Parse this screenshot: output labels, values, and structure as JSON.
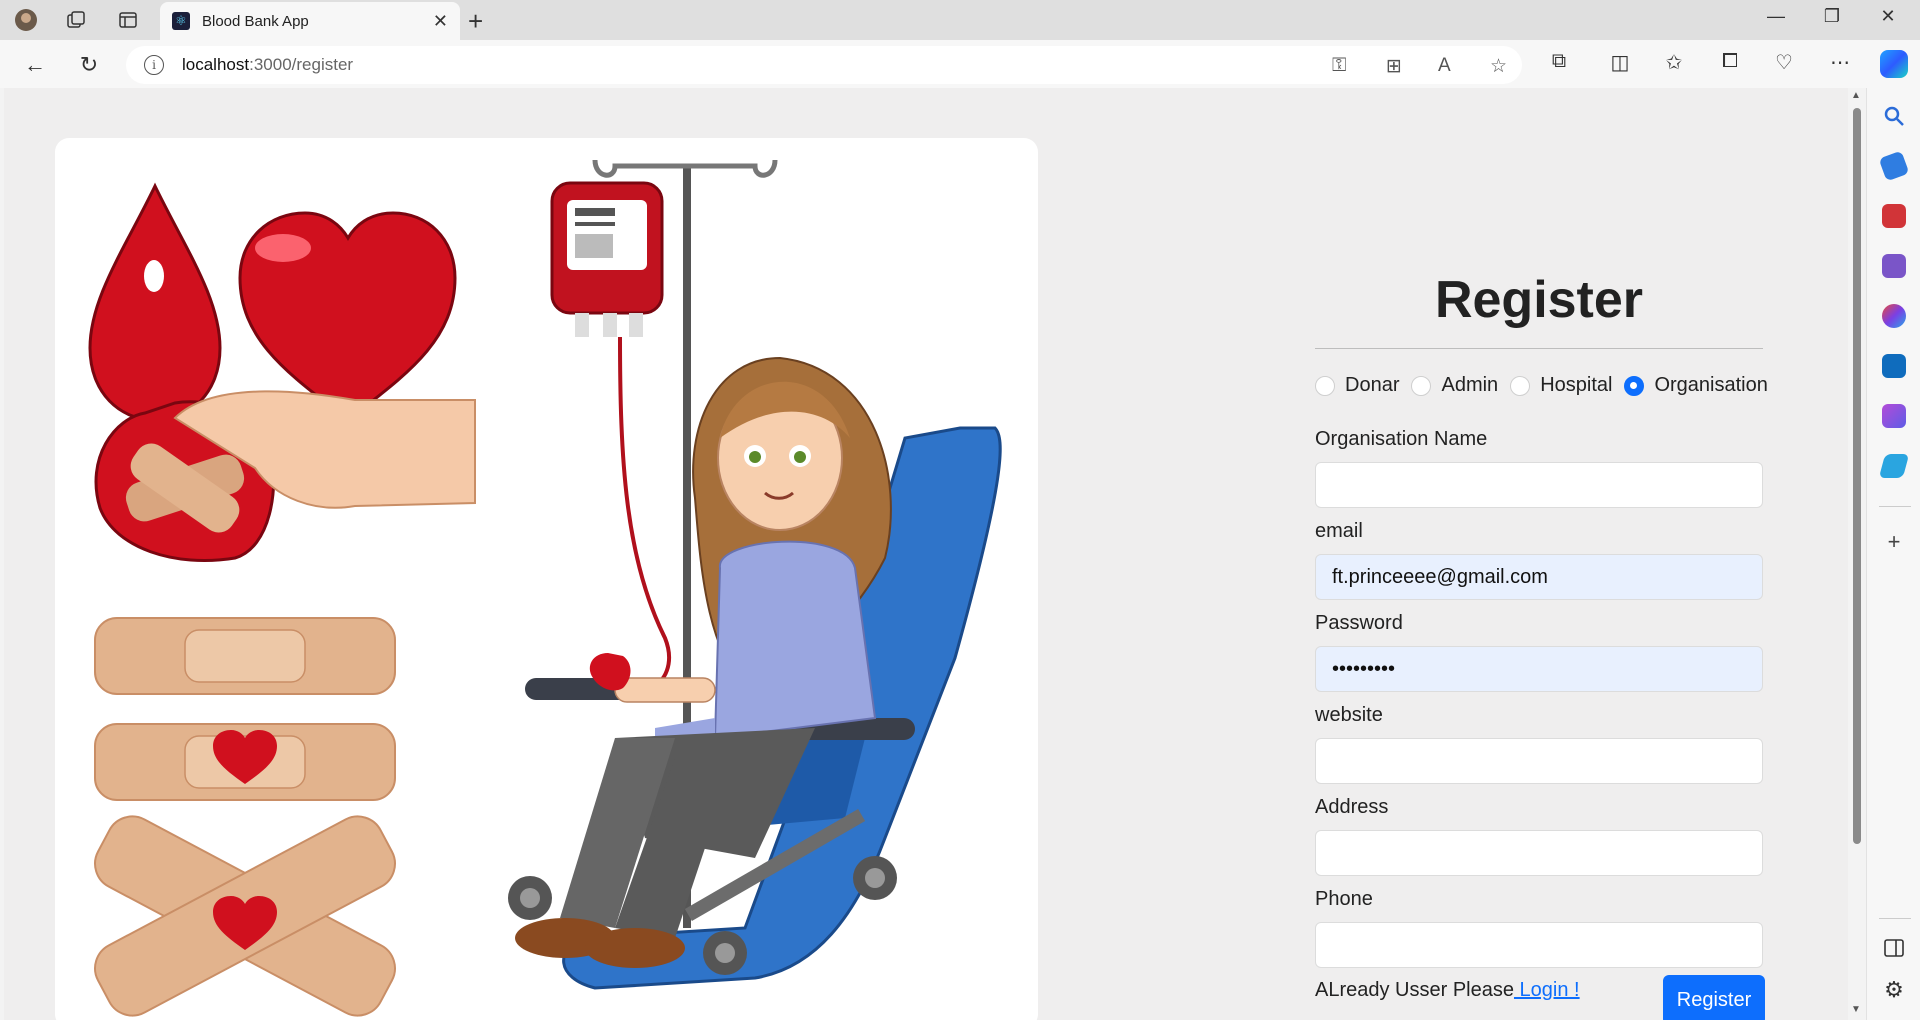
{
  "browser": {
    "tab_title": "Blood Bank App",
    "url_host": "localhost",
    "url_path": ":3000/register",
    "new_tab": "+",
    "tab_close": "✕"
  },
  "register": {
    "title": "Register",
    "roles": [
      {
        "label": "Donar",
        "checked": false
      },
      {
        "label": "Admin",
        "checked": false
      },
      {
        "label": "Hospital",
        "checked": false
      },
      {
        "label": "Organisation",
        "checked": true
      }
    ],
    "fields": {
      "org_name_label": "Organisation Name",
      "org_name_value": "",
      "email_label": "email",
      "email_value": "ft.princeeee@gmail.com",
      "password_label": "Password",
      "password_value": "•••••••••",
      "website_label": "website",
      "website_value": "",
      "address_label": "Address",
      "address_value": "",
      "phone_label": "Phone",
      "phone_value": ""
    },
    "login_prompt": "ALready Usser Please",
    "login_link": " Login !",
    "submit_label": "Register"
  },
  "colors": {
    "accent": "#0d6efd",
    "blood_red": "#d0101e",
    "chair_blue": "#2f74c9"
  },
  "icons": [
    "back-icon",
    "refresh-icon",
    "info-icon",
    "key-icon",
    "apps-icon",
    "read-aloud-icon",
    "star-icon",
    "extensions-icon",
    "split-screen-icon",
    "favorites-icon",
    "collections-icon",
    "health-icon",
    "more-icon",
    "copilot-icon",
    "search-icon",
    "tag-icon",
    "toolbox-icon",
    "games-icon",
    "office-icon",
    "outlook-icon",
    "designer-icon",
    "send-icon",
    "add-icon",
    "sidebar-toggle-icon",
    "settings-icon"
  ]
}
